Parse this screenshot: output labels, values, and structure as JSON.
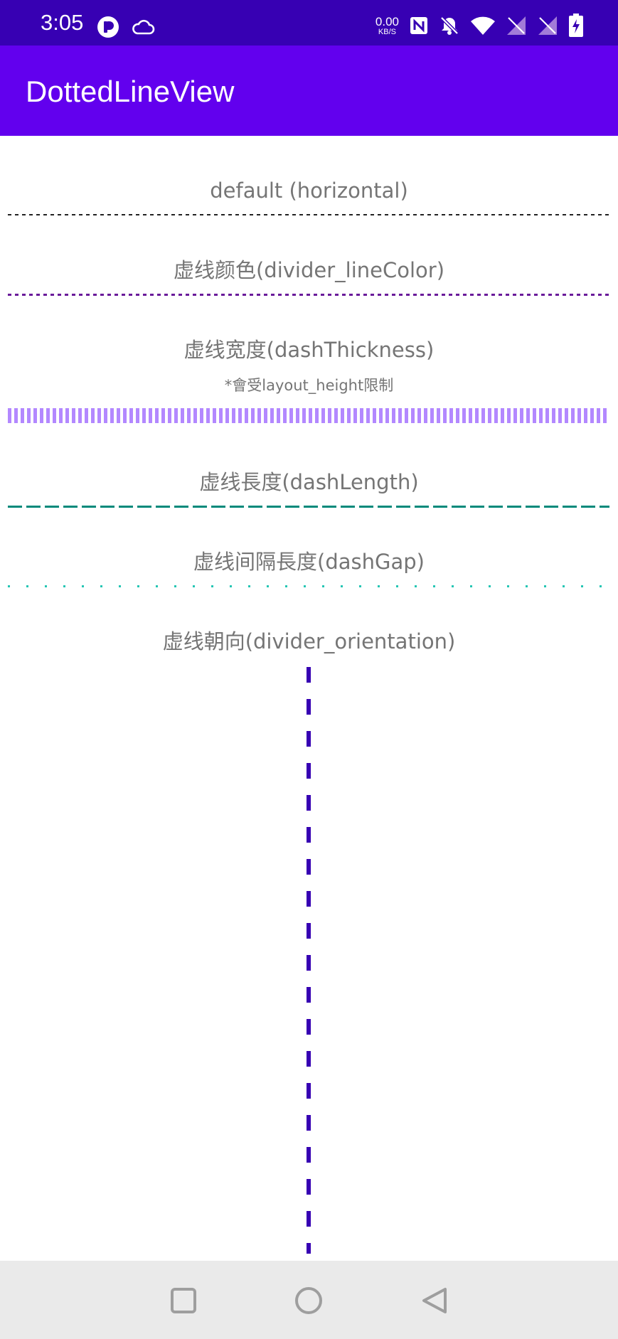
{
  "status_bar": {
    "time": "3:05",
    "net_speed_value": "0.00",
    "net_speed_unit": "KB/S",
    "left_icons": [
      "app-notification-icon",
      "cloud-icon"
    ],
    "right_icons": [
      "nfc-icon",
      "bell-off-icon",
      "wifi-icon",
      "sim-no-signal-icon",
      "sim-no-signal-icon",
      "battery-charging-icon"
    ]
  },
  "app_bar": {
    "title": "DottedLineView"
  },
  "sections": {
    "default_label": "default (horizontal)",
    "color_label": "虚线颜色(divider_lineColor)",
    "thickness_label": "虚线宽度(dashThickness)",
    "thickness_note": "*會受layout_height限制",
    "length_label": "虚线長度(dashLength)",
    "gap_label": "虚线间隔長度(dashGap)",
    "orientation_label": "虚线朝向(divider_orientation)"
  },
  "colors": {
    "status_bar": "#3700b3",
    "app_bar": "#6200ee",
    "default_line": "#222222",
    "color_line": "#6a1b9a",
    "thickness_line": "#b388ff",
    "length_line": "#00897b",
    "gap_line": "#26c6b4",
    "orientation_line": "#3700b3",
    "label_text": "#757575",
    "nav_bar": "#eaeaea"
  },
  "nav_bar": {
    "buttons": [
      "recents-square-icon",
      "home-circle-icon",
      "back-triangle-icon"
    ]
  }
}
